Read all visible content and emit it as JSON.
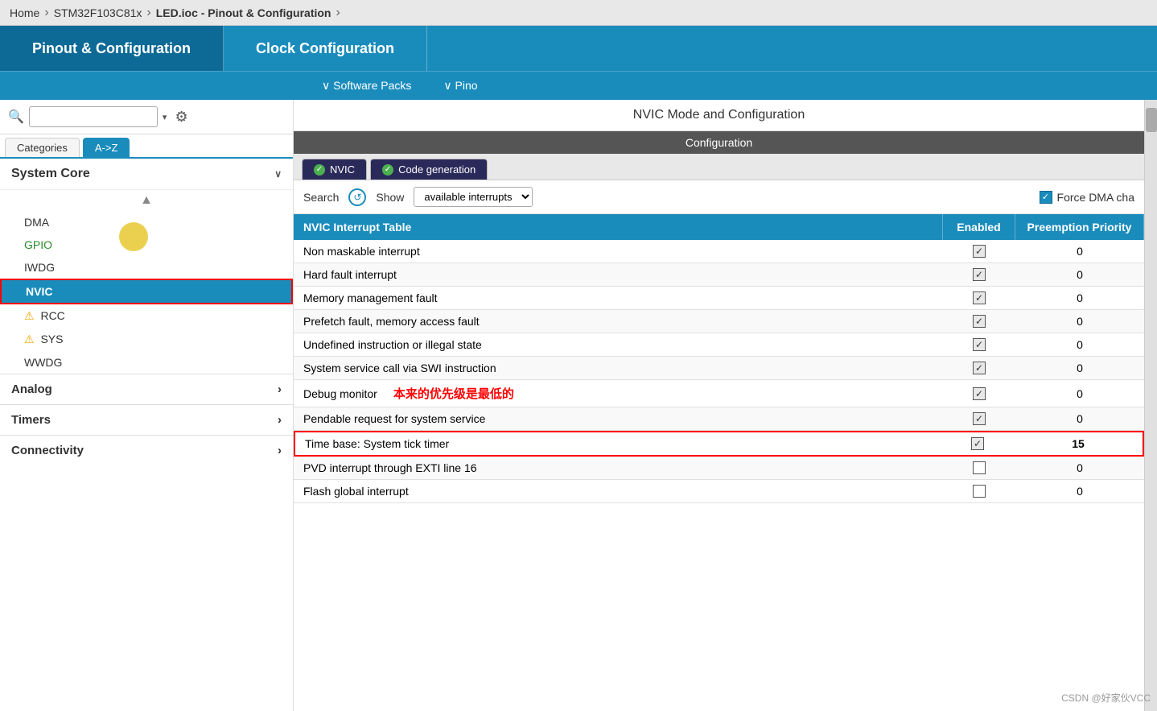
{
  "breadcrumb": {
    "items": [
      "Home",
      "STM32F103C81x",
      "LED.ioc - Pinout & Configuration"
    ]
  },
  "top_tabs": {
    "tab1_label": "Pinout & Configuration",
    "tab2_label": "Clock Configuration",
    "software_packs_label": "∨ Software Packs",
    "pinout_label": "∨ Pino"
  },
  "sidebar": {
    "search_placeholder": "",
    "tab_categories": "Categories",
    "tab_az": "A->Z",
    "section_system_core": "System Core",
    "items": [
      {
        "label": "DMA",
        "type": "normal"
      },
      {
        "label": "GPIO",
        "type": "green"
      },
      {
        "label": "IWDG",
        "type": "normal"
      },
      {
        "label": "NVIC",
        "type": "active"
      },
      {
        "label": "RCC",
        "type": "warning"
      },
      {
        "label": "SYS",
        "type": "warning"
      },
      {
        "label": "WWDG",
        "type": "normal"
      }
    ],
    "section_analog": "Analog",
    "section_timers": "Timers",
    "section_connectivity": "Connectivity"
  },
  "content": {
    "mode_title": "NVIC Mode and Configuration",
    "config_label": "Configuration",
    "tab_nvic": "NVIC",
    "tab_code_gen": "Code generation",
    "search_label": "Search",
    "show_label": "Show",
    "dropdown_value": "available interrupts",
    "force_dma_label": "Force DMA cha",
    "table": {
      "col1": "NVIC Interrupt Table",
      "col2": "Enabled",
      "col3": "Preemption Priority",
      "rows": [
        {
          "name": "Non maskable interrupt",
          "enabled": true,
          "priority": "0",
          "highlight": false
        },
        {
          "name": "Hard fault interrupt",
          "enabled": true,
          "priority": "0",
          "highlight": false
        },
        {
          "name": "Memory management fault",
          "enabled": true,
          "priority": "0",
          "highlight": false
        },
        {
          "name": "Prefetch fault, memory access fault",
          "enabled": true,
          "priority": "0",
          "highlight": false
        },
        {
          "name": "Undefined instruction or illegal state",
          "enabled": true,
          "priority": "0",
          "highlight": false
        },
        {
          "name": "System service call via SWI instruction",
          "enabled": true,
          "priority": "0",
          "highlight": false
        },
        {
          "name": "Debug monitor",
          "enabled": true,
          "priority": "0",
          "highlight": false,
          "annotation": "本来的优先级是最低的"
        },
        {
          "name": "Pendable request for system service",
          "enabled": true,
          "priority": "0",
          "highlight": false
        },
        {
          "name": "Time base: System tick timer",
          "enabled": true,
          "priority": "15",
          "highlight": true
        },
        {
          "name": "PVD interrupt through EXTI line 16",
          "enabled": false,
          "priority": "0",
          "highlight": false
        },
        {
          "name": "Flash global interrupt",
          "enabled": false,
          "priority": "0",
          "highlight": false
        }
      ]
    }
  },
  "watermark": "CSDN @好家伙VCC"
}
